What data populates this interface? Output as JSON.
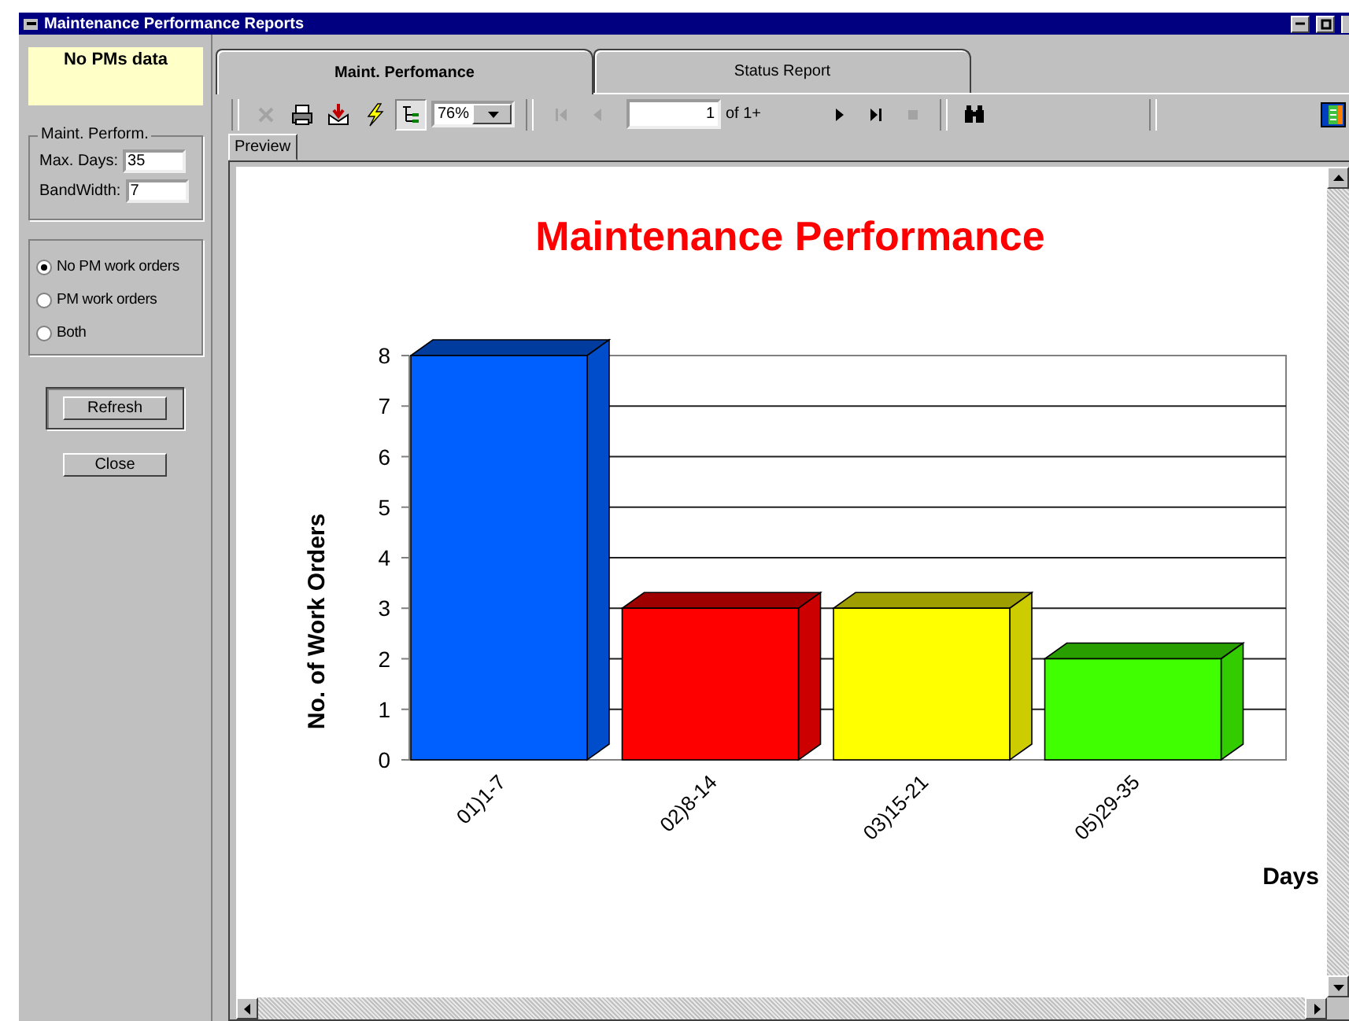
{
  "window": {
    "title": "Maintenance Performance Reports"
  },
  "side_panel": {
    "notice": "No PMs data",
    "group": {
      "title": "Maint. Perform.",
      "fields": [
        {
          "label": "Max. Days:",
          "value": "35"
        },
        {
          "label": "BandWidth:",
          "value": "7"
        }
      ]
    },
    "filters": [
      {
        "label": "No PM work orders",
        "selected": true
      },
      {
        "label": "PM work orders",
        "selected": false
      },
      {
        "label": "Both",
        "selected": false
      }
    ],
    "buttons": [
      {
        "label": "Refresh",
        "default": true
      },
      {
        "label": "Close",
        "default": false
      }
    ]
  },
  "tabs": [
    {
      "label": "Maint. Perfomance",
      "selected": true
    },
    {
      "label": "Status Report",
      "selected": false
    }
  ],
  "toolbar": {
    "items": [
      {
        "kind": "separator"
      },
      {
        "kind": "close",
        "disabled": true,
        "pressed": false
      },
      {
        "kind": "print",
        "disabled": false,
        "pressed": false
      },
      {
        "kind": "export",
        "disabled": false,
        "pressed": false
      },
      {
        "kind": "lightning",
        "disabled": false,
        "pressed": false
      },
      {
        "kind": "tree",
        "disabled": false,
        "pressed": true
      },
      {
        "kind": "zoom",
        "value": "76%"
      },
      {
        "kind": "separator"
      },
      {
        "kind": "first",
        "disabled": true,
        "pressed": false
      },
      {
        "kind": "prev",
        "disabled": true,
        "pressed": false
      },
      {
        "kind": "page",
        "value": "1"
      },
      {
        "kind": "label",
        "text": "of 1+"
      },
      {
        "kind": "spacer"
      },
      {
        "kind": "next",
        "disabled": false,
        "pressed": false
      },
      {
        "kind": "last",
        "disabled": false,
        "pressed": false
      },
      {
        "kind": "stop",
        "disabled": true,
        "pressed": false
      },
      {
        "kind": "separator"
      },
      {
        "kind": "find",
        "disabled": false,
        "pressed": false
      },
      {
        "kind": "flex"
      },
      {
        "kind": "separator"
      },
      {
        "kind": "flex"
      },
      {
        "kind": "app",
        "disabled": false,
        "pressed": false
      }
    ]
  },
  "viewer_tabs": [
    {
      "label": "Preview",
      "selected": true
    }
  ],
  "report": {
    "chart_data": {
      "type": "bar",
      "title": "Maintenance Performance",
      "xlabel": "Days",
      "ylabel": "No. of Work Orders",
      "categories": [
        "01)1-7",
        "02)8-14",
        "03)15-21",
        "05)29-35"
      ],
      "values": [
        8,
        3,
        3,
        2
      ],
      "colors": [
        "#0060ff",
        "#ff0000",
        "#ffff00",
        "#40ff00"
      ],
      "ylim": [
        0,
        8
      ],
      "yticks": [
        0,
        1,
        2,
        3,
        4,
        5,
        6,
        7,
        8
      ],
      "grid": true
    }
  }
}
